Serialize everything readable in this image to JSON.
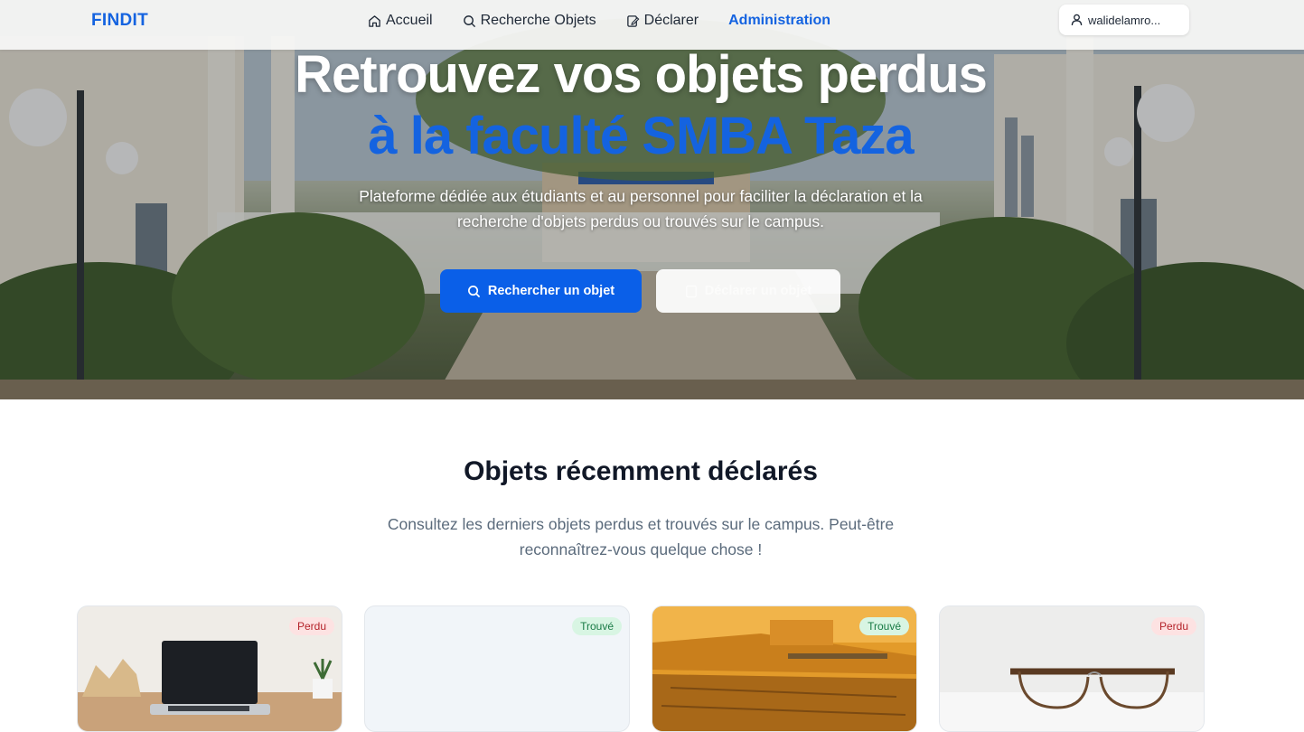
{
  "nav": {
    "brand": "FINDIT",
    "links": [
      {
        "label": "Accueil",
        "icon": "home-icon"
      },
      {
        "label": "Recherche Objets",
        "icon": "search-icon"
      },
      {
        "label": "Déclarer",
        "icon": "edit-icon"
      },
      {
        "label": "Administration",
        "icon": ""
      }
    ],
    "user": "walidelamro..."
  },
  "hero": {
    "title_line1": "Retrouvez vos objets perdus",
    "title_line2": "à la faculté SMBA Taza",
    "subtitle": "Plateforme dédiée aux étudiants et au personnel pour faciliter la déclaration et la recherche d'objets perdus ou trouvés sur le campus.",
    "primary_button": "Rechercher un objet",
    "secondary_button": "Déclarer un objet"
  },
  "recent": {
    "title": "Objets récemment déclarés",
    "subtitle": "Consultez les derniers objets perdus et trouvés sur le campus. Peut-être reconnaîtrez-vous quelque chose !",
    "cards": [
      {
        "status": "Perdu",
        "image": "laptop"
      },
      {
        "status": "Trouvé",
        "image": "none"
      },
      {
        "status": "Trouvé",
        "image": "ruins"
      },
      {
        "status": "Perdu",
        "image": "glasses"
      }
    ]
  },
  "colors": {
    "accent": "#1463e0",
    "lost_badge": "#fde2e2",
    "found_badge": "#d8f5e3"
  }
}
